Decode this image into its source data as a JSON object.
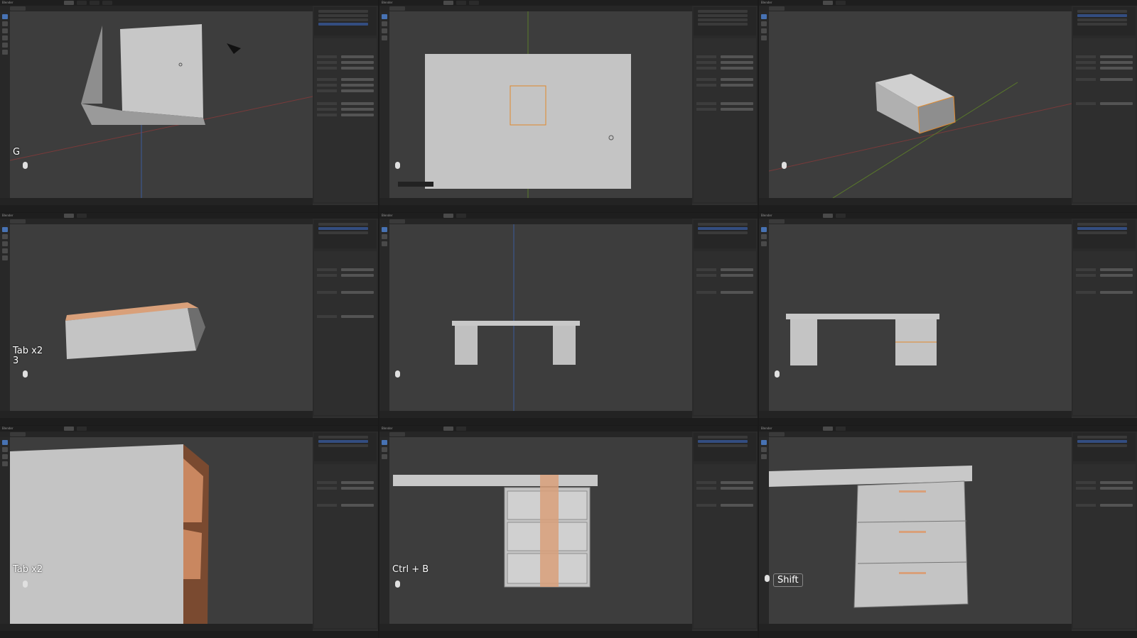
{
  "app": {
    "name": "Blender"
  },
  "panels": [
    {
      "id": "p1",
      "key_hint": [
        "G"
      ]
    },
    {
      "id": "p2",
      "key_hint": []
    },
    {
      "id": "p3",
      "key_hint": []
    },
    {
      "id": "p4",
      "key_hint": [
        "Tab x2",
        "3"
      ]
    },
    {
      "id": "p5",
      "key_hint": []
    },
    {
      "id": "p6",
      "key_hint": []
    },
    {
      "id": "p7",
      "key_hint": [
        "Tab x2"
      ]
    },
    {
      "id": "p8",
      "key_hint": [
        "Ctrl + B"
      ]
    },
    {
      "id": "p9",
      "key_hint": [
        "Shift"
      ]
    }
  ],
  "colors": {
    "viewport_bg": "#3d3d3d",
    "mesh_face": "#b8b8b8",
    "mesh_dark": "#8e8e8e",
    "selection_orange": "#d9a07a",
    "outline_orange": "#e0892d",
    "axis_red": "#9a3a3a",
    "axis_green": "#5a7a2a",
    "axis_blue": "#3a5a9a"
  }
}
